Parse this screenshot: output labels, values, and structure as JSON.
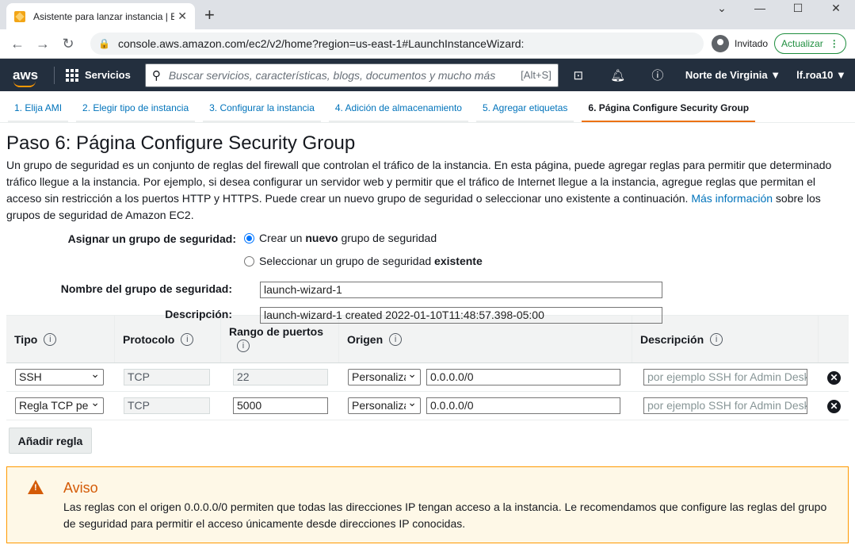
{
  "browser": {
    "tab_title": "Asistente para lanzar instancia | E",
    "tab_close": "✕",
    "new_tab": "+",
    "win_min": "⌄",
    "win_min2": "—",
    "win_max": "☐",
    "win_close": "✕",
    "back": "←",
    "forward": "→",
    "reload": "↻",
    "url": "console.aws.amazon.com/ec2/v2/home?region=us-east-1#LaunchInstanceWizard:",
    "guest_label": "Invitado",
    "update_label": "Actualizar"
  },
  "aws": {
    "logo": "aws",
    "services": "Servicios",
    "search_placeholder": "Buscar servicios, características, blogs, documentos y mucho más",
    "search_shortcut": "[Alt+S]",
    "region": "Norte de Virginia ▼",
    "user": "lf.roa10 ▼"
  },
  "wizard": {
    "steps": [
      "1. Elija AMI",
      "2. Elegir tipo de instancia",
      "3. Configurar la instancia",
      "4. Adición de almacenamiento",
      "5. Agregar etiquetas",
      "6. Página Configure Security Group"
    ]
  },
  "page": {
    "title": "Paso 6: Página Configure Security Group",
    "intro": "Un grupo de seguridad es un conjunto de reglas del firewall que controlan el tráfico de la instancia. En esta página, puede agregar reglas para permitir que determinado tráfico llegue a la instancia. Por ejemplo, si desea configurar un servidor web y permitir que el tráfico de Internet llegue a la instancia, agregue reglas que permitan el acceso sin restricción a los puertos HTTP y HTTPS. Puede crear un nuevo grupo de seguridad o seleccionar uno existente a continuación.",
    "intro_link": "Más información",
    "intro_tail": "sobre los grupos de seguridad de Amazon EC2."
  },
  "form": {
    "assign_label": "Asignar un grupo de seguridad:",
    "radio_new_pre": "Crear un",
    "radio_new_bold": "nuevo",
    "radio_new_post": "grupo de seguridad",
    "radio_existing_pre": "Seleccionar un grupo de seguridad",
    "radio_existing_bold": "existente",
    "name_label": "Nombre del grupo de seguridad:",
    "name_value": "launch-wizard-1",
    "desc_label": "Descripción:",
    "desc_value": "launch-wizard-1 created 2022-01-10T11:48:57.398-05:00"
  },
  "rules": {
    "headers": [
      "Tipo",
      "Protocolo",
      "Rango de puertos",
      "Origen",
      "Descripción"
    ],
    "info_glyph": "i",
    "rows": [
      {
        "type": "SSH",
        "protocol": "TCP",
        "port": "22",
        "source_type": "Personaliza",
        "source": "0.0.0.0/0",
        "desc_placeholder": "por ejemplo SSH for Admin Desktop"
      },
      {
        "type": "Regla TCP pe",
        "protocol": "TCP",
        "port": "5000",
        "source_type": "Personaliza",
        "source": "0.0.0.0/0",
        "desc_placeholder": "por ejemplo SSH for Admin Desktop"
      }
    ],
    "delete_glyph": "✕",
    "add_button": "Añadir regla"
  },
  "warning": {
    "title": "Aviso",
    "body": "Las reglas con el origen 0.0.0.0/0 permiten que todas las direcciones IP tengan acceso a la instancia. Le recomendamos que configure las reglas del grupo de seguridad para permitir el acceso únicamente desde direcciones IP conocidas."
  }
}
